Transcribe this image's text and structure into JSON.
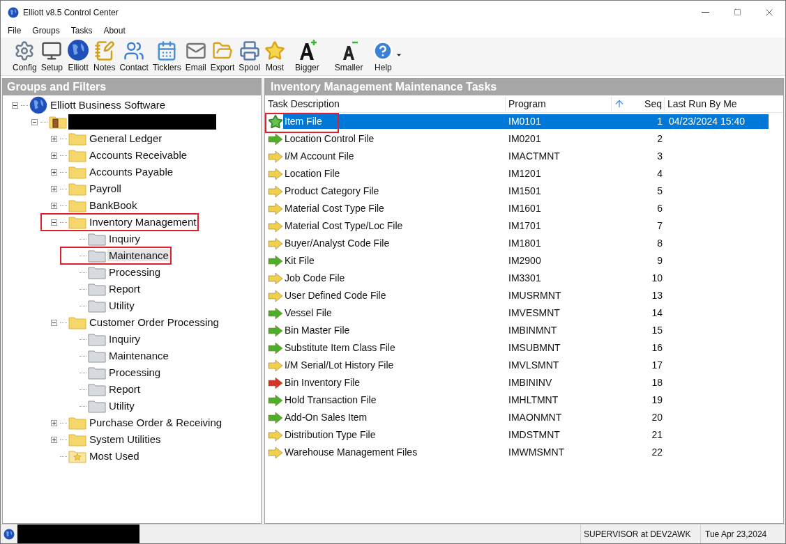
{
  "window": {
    "title": "Elliott v8.5 Control Center"
  },
  "menu": [
    "File",
    "Groups",
    "Tasks",
    "About"
  ],
  "toolbar": [
    {
      "label": "Config",
      "kind": "gear"
    },
    {
      "label": "Setup",
      "kind": "computer"
    },
    {
      "label": "Elliott",
      "kind": "globe"
    },
    {
      "label": "Notes",
      "kind": "notes"
    },
    {
      "label": "Contact",
      "kind": "contact"
    },
    {
      "label": "Ticklers",
      "kind": "calendar"
    },
    {
      "label": "Email",
      "kind": "mail"
    },
    {
      "label": "Export",
      "kind": "export"
    },
    {
      "label": "Spool",
      "kind": "printer"
    },
    {
      "label": "Most",
      "kind": "star"
    },
    {
      "label": "Bigger",
      "kind": "bigger"
    },
    {
      "label": "Smaller",
      "kind": "smaller"
    },
    {
      "label": "Help",
      "kind": "help"
    }
  ],
  "left_panel": {
    "title": "Groups and Filters",
    "tree": [
      {
        "label": "Elliott Business Software",
        "kind": "root",
        "expanded": true,
        "children": [
          {
            "kind": "company",
            "redacted": true,
            "expanded": true,
            "children": [
              {
                "label": "General Ledger",
                "kind": "folder",
                "expanded": false
              },
              {
                "label": "Accounts Receivable",
                "kind": "folder",
                "expanded": false
              },
              {
                "label": "Accounts Payable",
                "kind": "folder",
                "expanded": false
              },
              {
                "label": "Payroll",
                "kind": "folder",
                "expanded": false
              },
              {
                "label": "BankBook",
                "kind": "folder",
                "expanded": false
              },
              {
                "label": "Inventory Management",
                "kind": "folder",
                "expanded": true,
                "annotated": true,
                "children": [
                  {
                    "label": "Inquiry",
                    "kind": "subfolder",
                    "selected": false
                  },
                  {
                    "label": "Maintenance",
                    "kind": "subfolder",
                    "selected": true,
                    "annotated": true
                  },
                  {
                    "label": "Processing",
                    "kind": "subfolder",
                    "selected": false
                  },
                  {
                    "label": "Report",
                    "kind": "subfolder",
                    "selected": false
                  },
                  {
                    "label": "Utility",
                    "kind": "subfolder",
                    "selected": false
                  }
                ]
              },
              {
                "label": "Customer Order Processing",
                "kind": "folder",
                "expanded": true,
                "children": [
                  {
                    "label": "Inquiry",
                    "kind": "subfolder",
                    "selected": false
                  },
                  {
                    "label": "Maintenance",
                    "kind": "subfolder",
                    "selected": false
                  },
                  {
                    "label": "Processing",
                    "kind": "subfolder",
                    "selected": false
                  },
                  {
                    "label": "Report",
                    "kind": "subfolder",
                    "selected": false
                  },
                  {
                    "label": "Utility",
                    "kind": "subfolder",
                    "selected": false
                  }
                ]
              },
              {
                "label": "Purchase Order & Receiving",
                "kind": "folder",
                "expanded": false
              },
              {
                "label": "System Utilities",
                "kind": "folder",
                "expanded": false
              },
              {
                "label": "Most Used",
                "kind": "favorites"
              }
            ]
          }
        ]
      }
    ]
  },
  "right_panel": {
    "title": "Inventory Management Maintenance Tasks",
    "columns": [
      "Task Description",
      "Program",
      "Seq",
      "Last Run By Me"
    ],
    "rows": [
      {
        "task": "Item File",
        "program": "IM0101",
        "seq": "1",
        "last_run": "04/23/2024 15:40",
        "kind": "star",
        "selected": true,
        "annotated": true
      },
      {
        "task": "Location Control File",
        "program": "IM0201",
        "seq": "2",
        "kind": "arrow",
        "color": "#4caf2a",
        "selected": false
      },
      {
        "task": "I/M Account File",
        "program": "IMACTMNT",
        "seq": "3",
        "kind": "arrow",
        "color": "#f0cf4a",
        "selected": false
      },
      {
        "task": "Location File",
        "program": "IM1201",
        "seq": "4",
        "kind": "arrow",
        "color": "#f0cf4a",
        "selected": false
      },
      {
        "task": "Product Category File",
        "program": "IM1501",
        "seq": "5",
        "kind": "arrow",
        "color": "#f0cf4a",
        "selected": false
      },
      {
        "task": "Material Cost Type File",
        "program": "IM1601",
        "seq": "6",
        "kind": "arrow",
        "color": "#f0cf4a",
        "selected": false
      },
      {
        "task": "Material Cost Type/Loc File",
        "program": "IM1701",
        "seq": "7",
        "kind": "arrow",
        "color": "#f0cf4a",
        "selected": false
      },
      {
        "task": "Buyer/Analyst Code File",
        "program": "IM1801",
        "seq": "8",
        "kind": "arrow",
        "color": "#f0cf4a",
        "selected": false
      },
      {
        "task": "Kit File",
        "program": "IM2900",
        "seq": "9",
        "kind": "arrow",
        "color": "#4caf2a",
        "selected": false
      },
      {
        "task": "Job Code File",
        "program": "IM3301",
        "seq": "10",
        "kind": "arrow",
        "color": "#f0cf4a",
        "selected": false
      },
      {
        "task": "User Defined Code File",
        "program": "IMUSRMNT",
        "seq": "13",
        "kind": "arrow",
        "color": "#f0cf4a",
        "selected": false
      },
      {
        "task": "Vessel File",
        "program": "IMVESMNT",
        "seq": "14",
        "kind": "arrow",
        "color": "#4caf2a",
        "selected": false
      },
      {
        "task": "Bin Master File",
        "program": "IMBINMNT",
        "seq": "15",
        "kind": "arrow",
        "color": "#4caf2a",
        "selected": false
      },
      {
        "task": "Substitute Item Class File",
        "program": "IMSUBMNT",
        "seq": "16",
        "kind": "arrow",
        "color": "#4caf2a",
        "selected": false
      },
      {
        "task": "I/M Serial/Lot History File",
        "program": "IMVLSMNT",
        "seq": "17",
        "kind": "arrow",
        "color": "#f0cf4a",
        "selected": false
      },
      {
        "task": "Bin Inventory File",
        "program": "IMBININV",
        "seq": "18",
        "kind": "arrow",
        "color": "#d9302a",
        "selected": false
      },
      {
        "task": "Hold Transaction File",
        "program": "IMHLTMNT",
        "seq": "19",
        "kind": "arrow",
        "color": "#4caf2a",
        "selected": false
      },
      {
        "task": "Add-On Sales Item",
        "program": "IMAONMNT",
        "seq": "20",
        "kind": "arrow",
        "color": "#4caf2a",
        "selected": false
      },
      {
        "task": "Distribution Type File",
        "program": "IMDSTMNT",
        "seq": "21",
        "kind": "arrow",
        "color": "#f0cf4a",
        "selected": false
      },
      {
        "task": "Warehouse Management Files",
        "program": "IMWMSMNT",
        "seq": "22",
        "kind": "arrow",
        "color": "#f0cf4a",
        "selected": false
      }
    ]
  },
  "status_bar": {
    "redacted": true,
    "user": "SUPERVISOR at DEV2AWK",
    "date": "Tue Apr 23,2024"
  }
}
